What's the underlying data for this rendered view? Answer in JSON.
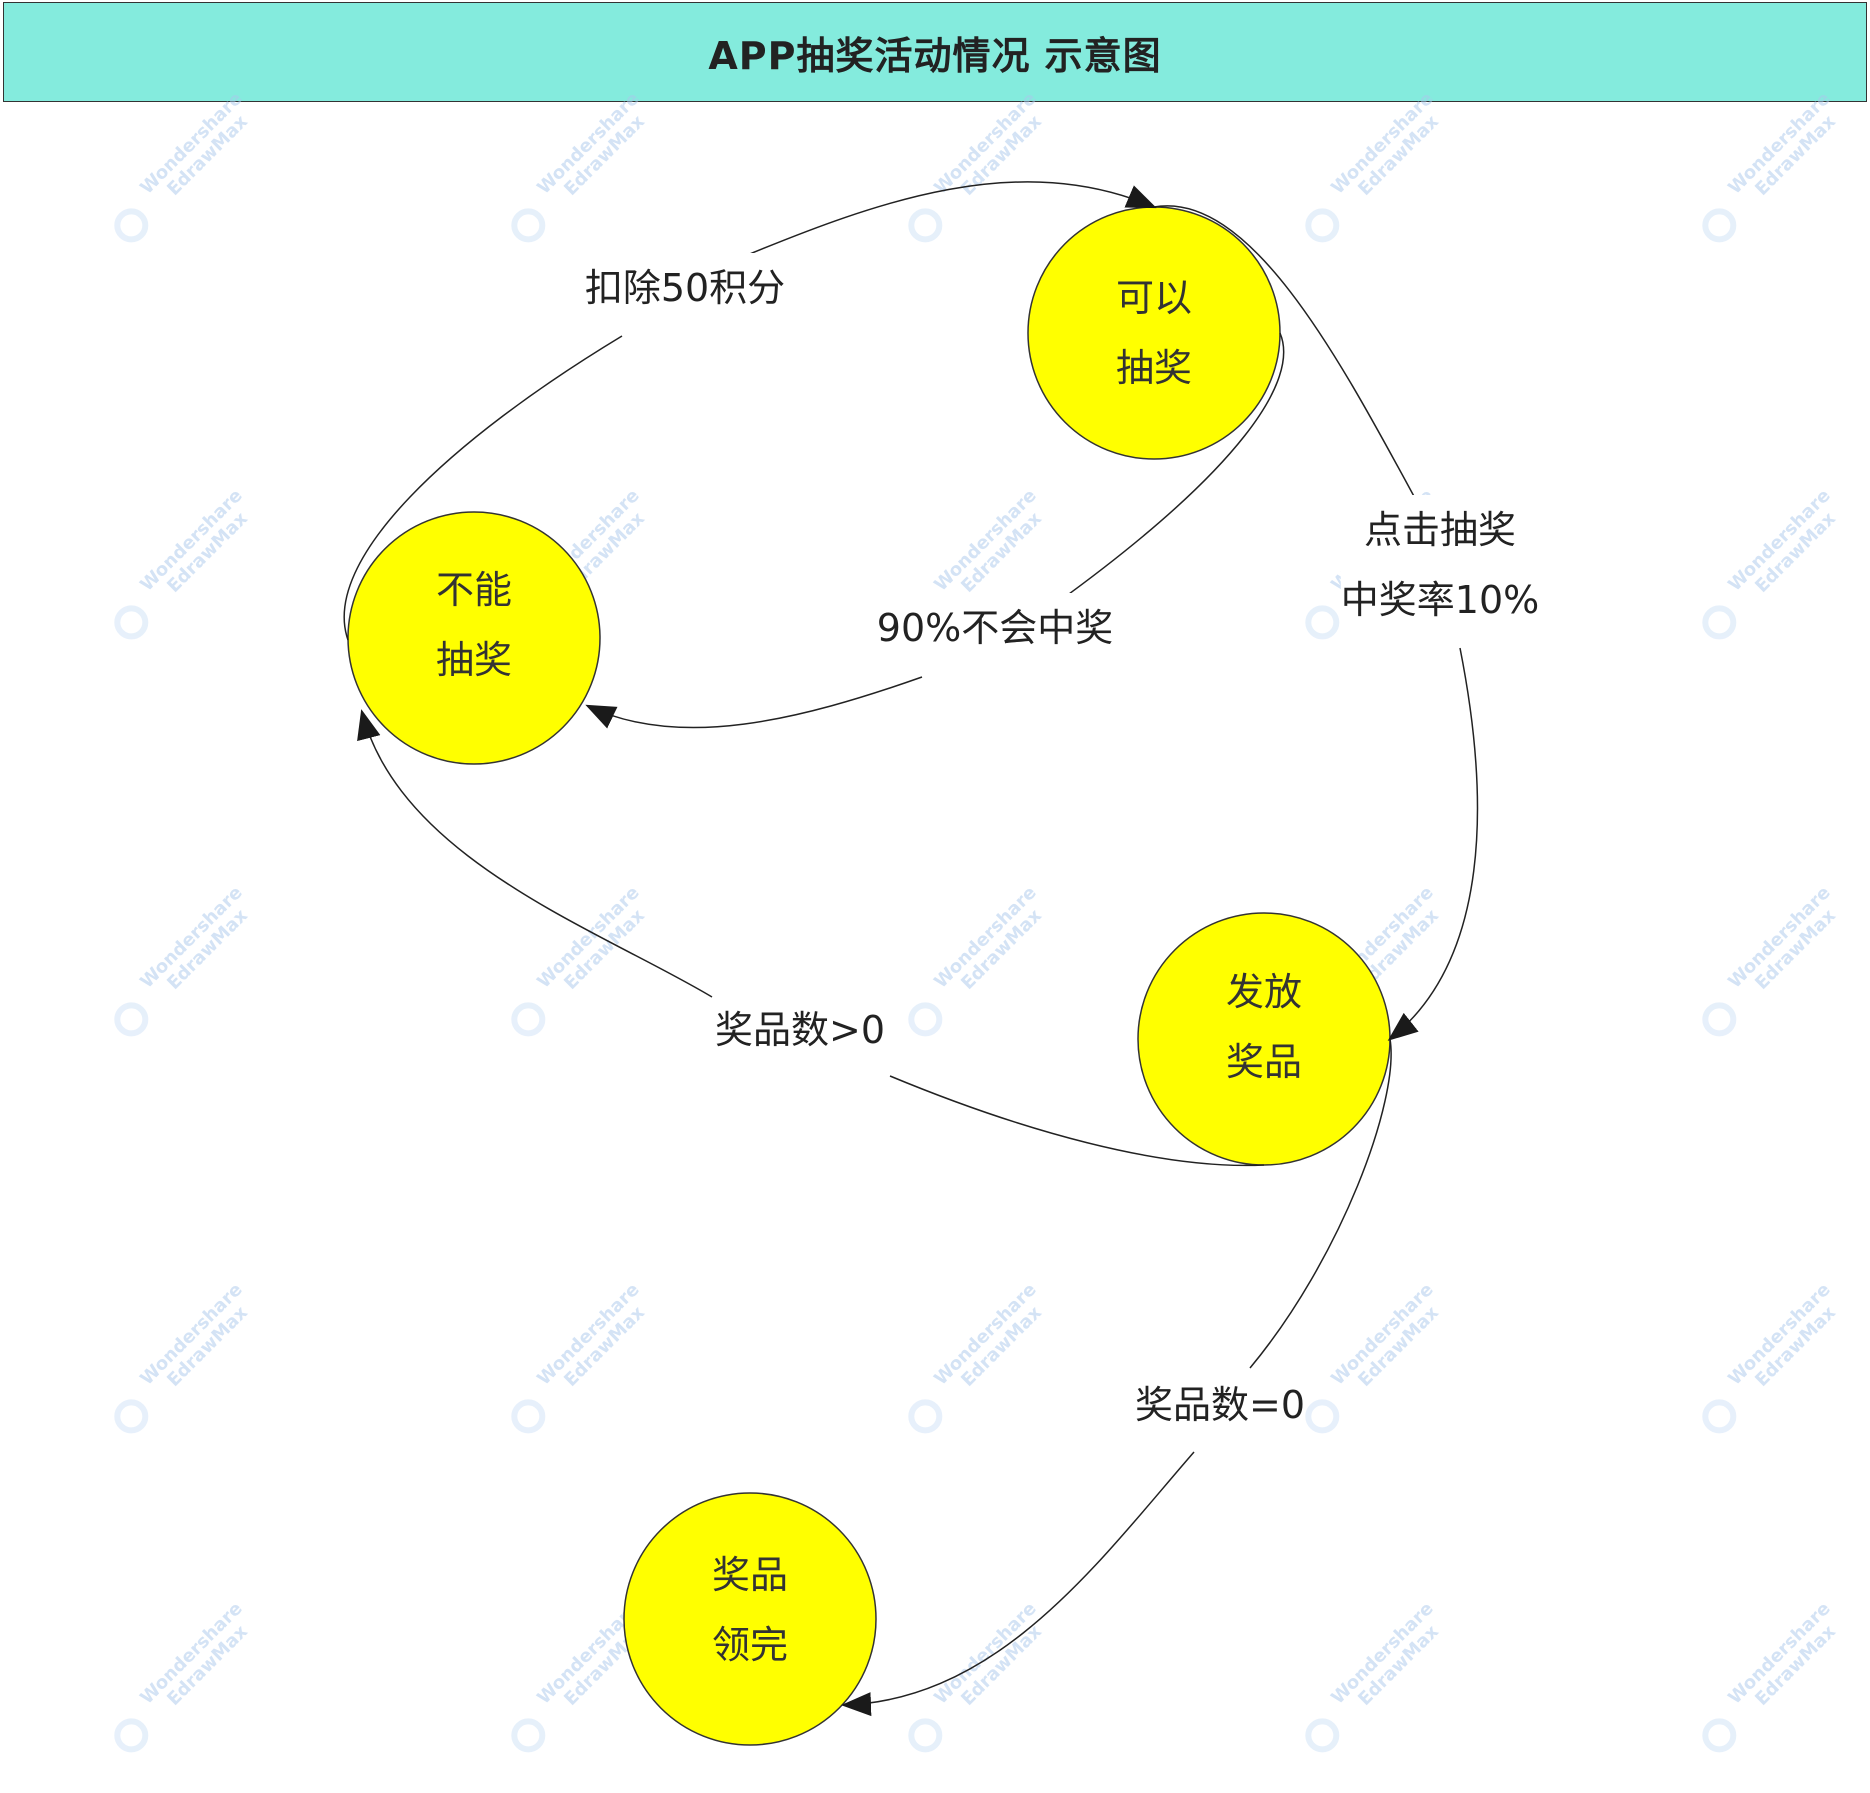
{
  "title": "APP抽奖活动情况 示意图",
  "colors": {
    "title_bg": "#84ebdd",
    "node_fill": "#ffff00",
    "node_stroke": "#333333",
    "edge": "#222222"
  },
  "nodes": [
    {
      "id": "can-draw",
      "line1": "可以",
      "line2": "抽奖"
    },
    {
      "id": "cannot-draw",
      "line1": "不能",
      "line2": "抽奖"
    },
    {
      "id": "issue-prize",
      "line1": "发放",
      "line2": "奖品"
    },
    {
      "id": "prizes-gone",
      "line1": "奖品",
      "line2": "领完"
    }
  ],
  "edges": [
    {
      "id": "deduct",
      "from": "cannot-draw",
      "to": "can-draw",
      "label": "扣除50积分"
    },
    {
      "id": "no-win",
      "from": "can-draw",
      "to": "cannot-draw",
      "label": "90%不会中奖"
    },
    {
      "id": "click-draw",
      "from": "can-draw",
      "to": "issue-prize",
      "label_line1": "点击抽奖",
      "label_line2": "中奖率10%"
    },
    {
      "id": "prize-gt0",
      "from": "issue-prize",
      "to": "cannot-draw",
      "label": "奖品数>0"
    },
    {
      "id": "prize-eq0",
      "from": "issue-prize",
      "to": "prizes-gone",
      "label": "奖品数=0"
    }
  ],
  "watermark": {
    "line1": "Wondershare",
    "line2": "EdrawMax"
  }
}
